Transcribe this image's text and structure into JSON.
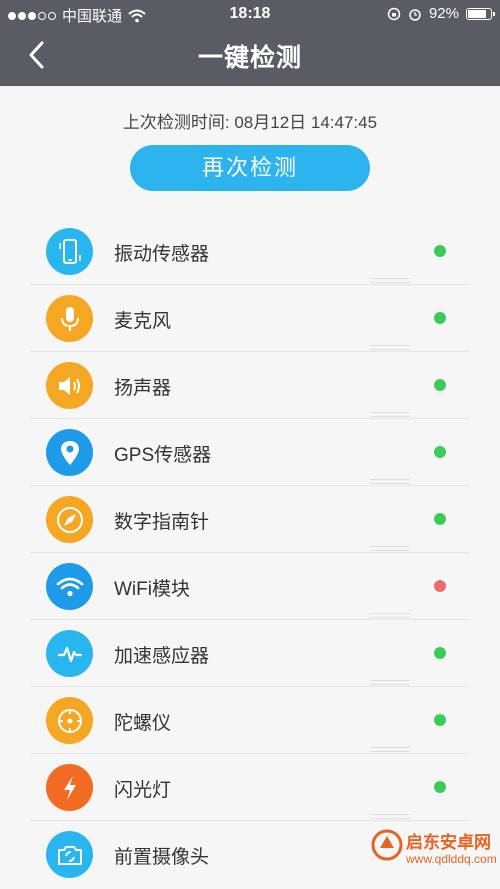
{
  "status_bar": {
    "carrier": "中国联通",
    "time": "18:18",
    "battery": "92%",
    "battery_level": 0.92
  },
  "nav": {
    "title": "一键检测",
    "back_icon": "chevron-left-icon"
  },
  "last_check": "上次检测时间: 08月12日 14:47:45",
  "recheck_button": "再次检测",
  "sensors": [
    {
      "label": "振动传感器",
      "icon": "phone-vibrate-icon",
      "color": "#29b6ef",
      "status_color": "#3ccb59"
    },
    {
      "label": "麦克风",
      "icon": "microphone-icon",
      "color": "#f5a623",
      "status_color": "#3ccb59"
    },
    {
      "label": "扬声器",
      "icon": "speaker-icon",
      "color": "#f5a623",
      "status_color": "#3ccb59"
    },
    {
      "label": "GPS传感器",
      "icon": "location-pin-icon",
      "color": "#1e9be8",
      "status_color": "#3ccb59"
    },
    {
      "label": "数字指南针",
      "icon": "compass-icon",
      "color": "#f5a623",
      "status_color": "#3ccb59"
    },
    {
      "label": "WiFi模块",
      "icon": "wifi-icon",
      "color": "#1e9be8",
      "status_color": "#ef6b6b"
    },
    {
      "label": "加速感应器",
      "icon": "pulse-icon",
      "color": "#29b6ef",
      "status_color": "#3ccb59"
    },
    {
      "label": "陀螺仪",
      "icon": "gyroscope-icon",
      "color": "#f5a623",
      "status_color": "#3ccb59"
    },
    {
      "label": "闪光灯",
      "icon": "flash-icon",
      "color": "#f26b22",
      "status_color": "#3ccb59"
    },
    {
      "label": "前置摄像头",
      "icon": "camera-switch-icon",
      "color": "#29b6ef",
      "status_color": ""
    }
  ],
  "watermark": {
    "name": "启东安卓网",
    "url": "www.qdlddq.com"
  }
}
